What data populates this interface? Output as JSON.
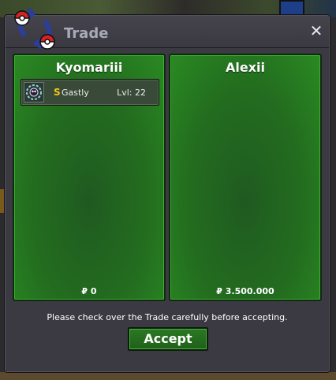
{
  "window": {
    "title": "Trade",
    "close_label": "✕",
    "logo_icon": "pokeball-swap-icon"
  },
  "left_panel": {
    "player_name": "Kyomariii",
    "money": "₽ 0",
    "items": [
      {
        "icon": "gastly-icon",
        "badge": "S",
        "name": "Gastly",
        "level": "Lvl: 22"
      }
    ]
  },
  "right_panel": {
    "player_name": "Alexii",
    "money": "₽ 3.500.000",
    "items": []
  },
  "notice": "Please check over the Trade carefully before accepting.",
  "accept_label": "Accept",
  "colors": {
    "panel_green": "#236d1f",
    "window_bg": "#3b3a42",
    "title_text": "#a9aab8",
    "badge_gold": "#f0c419"
  }
}
